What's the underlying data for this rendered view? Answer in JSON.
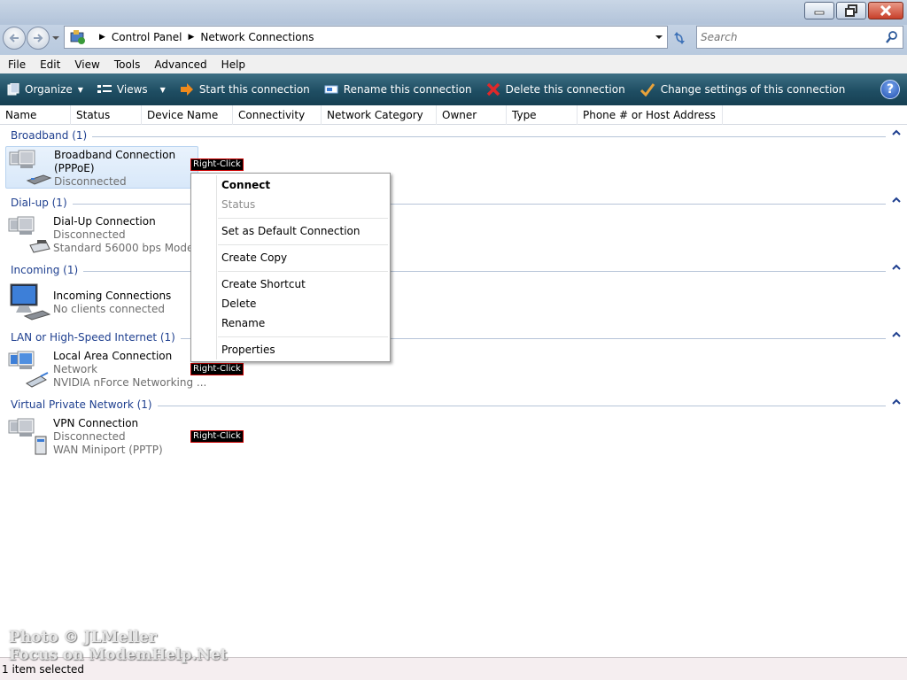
{
  "window": {
    "minimize_icon": "minimize-icon",
    "maximize_icon": "restore-icon",
    "close_icon": "close-icon"
  },
  "address": {
    "crumbs": [
      "Control Panel",
      "Network Connections"
    ],
    "search_placeholder": "Search"
  },
  "menu": [
    "File",
    "Edit",
    "View",
    "Tools",
    "Advanced",
    "Help"
  ],
  "commands": {
    "organize": "Organize",
    "views": "Views",
    "start": "Start this connection",
    "rename": "Rename this connection",
    "delete": "Delete this connection",
    "change": "Change settings of this connection",
    "help": "?"
  },
  "columns": [
    "Name",
    "Status",
    "Device Name",
    "Connectivity",
    "Network Category",
    "Owner",
    "Type",
    "Phone # or Host Address"
  ],
  "groups": [
    {
      "title": "Broadband (1)",
      "item": {
        "name": "Broadband Connection",
        "name2": "(PPPoE)",
        "line2": "Disconnected",
        "line3": ""
      }
    },
    {
      "title": "Dial-up (1)",
      "item": {
        "name": "Dial-Up Connection",
        "line2": "Disconnected",
        "line3": "Standard 56000 bps Modem"
      }
    },
    {
      "title": "Incoming (1)",
      "item": {
        "name": "Incoming Connections",
        "line2": "No clients connected",
        "line3": ""
      }
    },
    {
      "title": "LAN or High-Speed Internet (1)",
      "item": {
        "name": "Local Area Connection",
        "line2": "Network",
        "line3": "NVIDIA nForce Networking ..."
      }
    },
    {
      "title": "Virtual Private Network (1)",
      "item": {
        "name": "VPN Connection",
        "line2": "Disconnected",
        "line3": "WAN Miniport (PPTP)"
      }
    }
  ],
  "annotations": {
    "right_click": "Right-Click"
  },
  "context_menu": {
    "connect": "Connect",
    "status": "Status",
    "set_default": "Set as Default Connection",
    "create_copy": "Create Copy",
    "create_shortcut": "Create Shortcut",
    "delete": "Delete",
    "rename": "Rename",
    "properties": "Properties"
  },
  "status_bar": {
    "text": "1 item selected"
  },
  "watermark": {
    "line1": "Photo © JLMeller",
    "line2": "Focus on ModemHelp.Net"
  },
  "colors": {
    "command_bar": "#1f4e63",
    "group_title": "#1e3f8f",
    "selection": "#d8e8f9"
  }
}
